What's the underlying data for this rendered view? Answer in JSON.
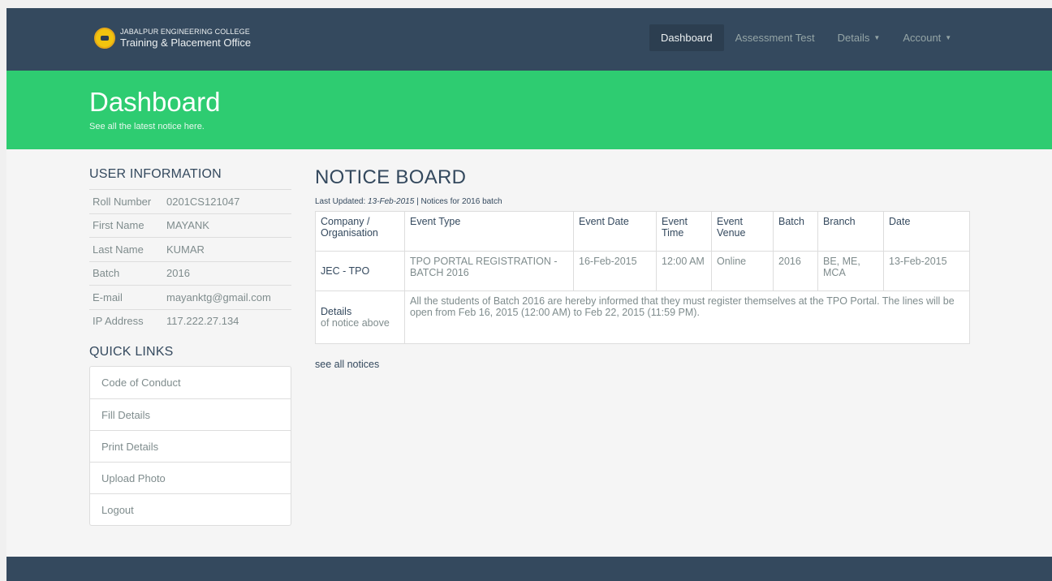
{
  "navbar": {
    "brand_line1": "JABALPUR ENGINEERING COLLEGE",
    "brand_line2": "Training & Placement Office",
    "items": [
      {
        "label": "Dashboard"
      },
      {
        "label": "Assessment Test"
      },
      {
        "label": "Details"
      },
      {
        "label": "Account"
      }
    ]
  },
  "hero": {
    "title": "Dashboard",
    "subtitle": "See all the latest notice here."
  },
  "user_info": {
    "heading": "USER INFORMATION",
    "rows": [
      {
        "label": "Roll Number",
        "value": "0201CS121047"
      },
      {
        "label": "First Name",
        "value": "MAYANK"
      },
      {
        "label": "Last Name",
        "value": "KUMAR"
      },
      {
        "label": "Batch",
        "value": "2016"
      },
      {
        "label": "E-mail",
        "value": "mayanktg@gmail.com"
      },
      {
        "label": "IP Address",
        "value": "117.222.27.134"
      }
    ]
  },
  "quick_links": {
    "heading": "QUICK LINKS",
    "items": [
      {
        "label": "Code of Conduct"
      },
      {
        "label": "Fill Details"
      },
      {
        "label": "Print Details"
      },
      {
        "label": "Upload Photo"
      },
      {
        "label": "Logout"
      }
    ]
  },
  "notice_board": {
    "title": "NOTICE BOARD",
    "updated_prefix": "Last Updated: ",
    "updated_date": "13-Feb-2015",
    "updated_suffix": " | Notices for 2016 batch",
    "headers": [
      "Company / Organisation",
      "Event Type",
      "Event Date",
      "Event Time",
      "Event Venue",
      "Batch",
      "Branch",
      "Date"
    ],
    "row": {
      "company": "JEC - TPO",
      "event_type": "TPO PORTAL REGISTRATION - BATCH 2016",
      "event_date": "16-Feb-2015",
      "event_time": "12:00 AM",
      "event_venue": "Online",
      "batch": "2016",
      "branch": "BE, ME, MCA",
      "date": "13-Feb-2015"
    },
    "details_label": "Details",
    "details_sub": "of notice above",
    "details_text": "All the students of Batch 2016 are hereby informed that they must register themselves at the TPO Portal. The lines will be open from Feb 16, 2015 (12:00 AM) to Feb 22, 2015 (11:59 PM).",
    "see_all": "see all notices"
  }
}
